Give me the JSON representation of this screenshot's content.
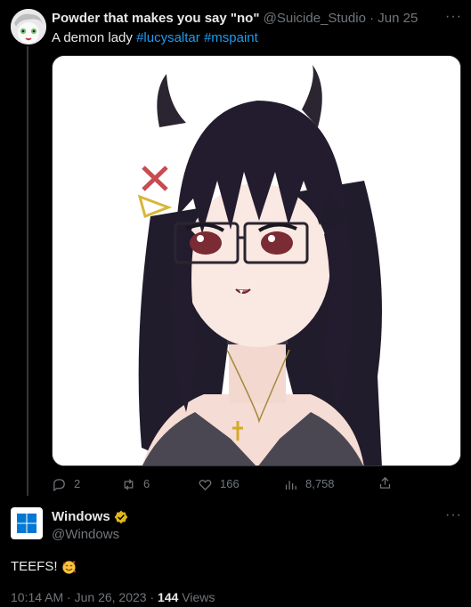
{
  "tweet1": {
    "name": "Powder that makes you say \"no\"",
    "handle": "@Suicide_Studio",
    "separator": "·",
    "date": "Jun 25",
    "text_prefix": "A demon lady ",
    "hashtag1": "#lucysaltar",
    "hashtag_space": " ",
    "hashtag2": "#mspaint",
    "more_label": "···",
    "actions": {
      "replies": "2",
      "retweets": "6",
      "likes": "166",
      "views": "8,758"
    }
  },
  "tweet2": {
    "name": "Windows",
    "handle": "@Windows",
    "more_label": "···",
    "text": "TEEFS!",
    "time": "10:14 AM",
    "separator": "·",
    "date": "Jun 26, 2023",
    "views_count": "144",
    "views_label": "Views"
  },
  "colors": {
    "background": "#000000",
    "text_primary": "#e7e9ea",
    "text_secondary": "#71767b",
    "link": "#1d9bf0",
    "verified_gold": "#e2b719",
    "windows_blue": "#0078d4"
  }
}
